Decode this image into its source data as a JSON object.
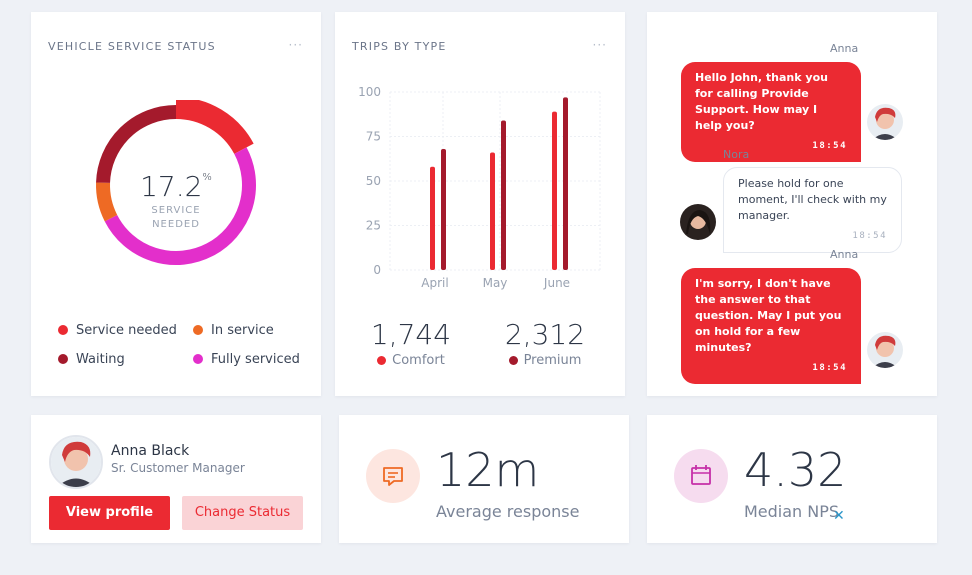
{
  "vehicle_card": {
    "title": "VEHICLE SERVICE STATUS",
    "more": "···",
    "center_value": "17.2",
    "center_unit": "%",
    "center_label_1": "SERVICE",
    "center_label_2": "NEEDED",
    "legend": [
      {
        "label": "Service needed",
        "color": "#eb2a32"
      },
      {
        "label": "In service",
        "color": "#ee6a24"
      },
      {
        "label": "Waiting",
        "color": "#a41a2c"
      },
      {
        "label": "Fully serviced",
        "color": "#e32fcb"
      }
    ],
    "segments": [
      {
        "name": "Service needed",
        "value": 17.2,
        "color": "#eb2a32"
      },
      {
        "name": "Fully serviced",
        "value": 50.3,
        "color": "#e32fcb"
      },
      {
        "name": "In service",
        "value": 8.0,
        "color": "#ee6a24"
      },
      {
        "name": "Waiting",
        "value": 24.5,
        "color": "#a41a2c"
      }
    ]
  },
  "trips_card": {
    "title": "TRIPS BY TYPE",
    "more": "···",
    "stats": [
      {
        "value": "1,744",
        "label": "Comfort",
        "color": "#eb2a32"
      },
      {
        "value": "2,312",
        "label": "Premium",
        "color": "#a41a2c"
      }
    ]
  },
  "chart_data": {
    "type": "bar",
    "categories": [
      "April",
      "May",
      "June"
    ],
    "series": [
      {
        "name": "Comfort",
        "values": [
          58,
          66,
          89
        ],
        "color": "#eb2a32"
      },
      {
        "name": "Premium",
        "values": [
          68,
          84,
          97
        ],
        "color": "#a41a2c"
      }
    ],
    "yticks": [
      0,
      25,
      50,
      75,
      100
    ],
    "ylim": [
      0,
      100
    ],
    "grid": true
  },
  "chat": {
    "messages": [
      {
        "sender": "Anna",
        "side": "right",
        "text": "Hello John, thank you for calling Provide Support. How may I help you?",
        "time": "18:54"
      },
      {
        "sender": "Nora",
        "side": "left",
        "text": "Please hold for one moment, I'll check with my manager.",
        "time": "18:54"
      },
      {
        "sender": "Anna",
        "side": "right",
        "text": "I'm sorry, I don't have the answer to that question. May I put you on hold for a few minutes?",
        "time": "18:54"
      }
    ]
  },
  "profile": {
    "name": "Anna Black",
    "role": "Sr. Customer Manager",
    "view_label": "View profile",
    "status_label": "Change Status"
  },
  "response": {
    "value": "12m",
    "label": "Average response",
    "icon": "message-icon",
    "icon_bg": "#fde6e0",
    "icon_color": "#ee6a24"
  },
  "nps": {
    "value": "4.32",
    "label": "Median NPS",
    "icon": "calendar-icon",
    "icon_bg": "#f6dcef",
    "icon_color": "#c62fa8",
    "close": "✕"
  }
}
